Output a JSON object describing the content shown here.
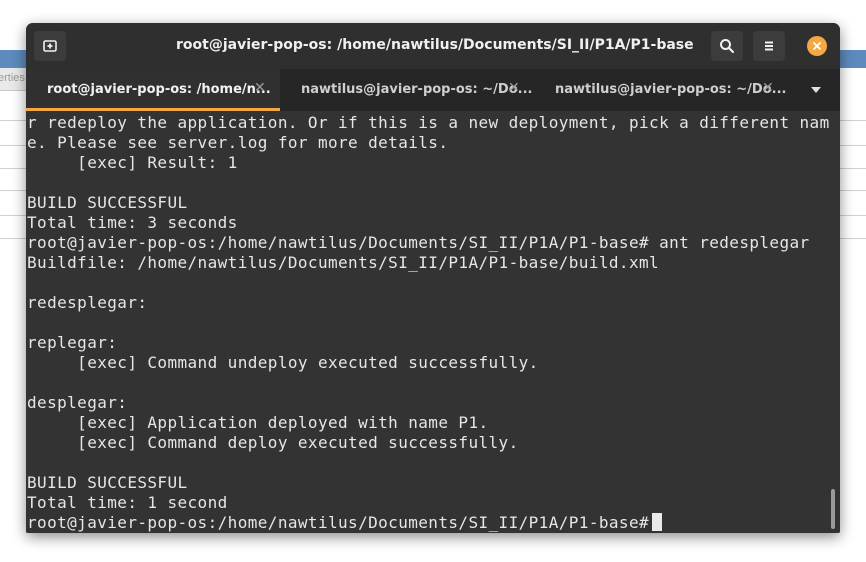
{
  "window": {
    "title": "root@javier-pop-os: /home/nawtilus/Documents/SI_II/P1A/P1-base"
  },
  "background": {
    "partial_label": "erties"
  },
  "tabs": [
    {
      "label": "root@javier-pop-os: /home/n...",
      "active": true
    },
    {
      "label": "nawtilus@javier-pop-os: ~/Do...",
      "active": false
    },
    {
      "label": "nawtilus@javier-pop-os: ~/Do...",
      "active": false
    }
  ],
  "terminal": {
    "lines": [
      "r redeploy the application. Or if this is a new deployment, pick a different nam",
      "e. Please see server.log for more details.",
      "     [exec] Result: 1",
      "",
      "BUILD SUCCESSFUL",
      "Total time: 3 seconds",
      "root@javier-pop-os:/home/nawtilus/Documents/SI_II/P1A/P1-base# ant redesplegar",
      "Buildfile: /home/nawtilus/Documents/SI_II/P1A/P1-base/build.xml",
      "",
      "redesplegar:",
      "",
      "replegar:",
      "     [exec] Command undeploy executed successfully.",
      "",
      "desplegar:",
      "     [exec] Application deployed with name P1.",
      "     [exec] Command deploy executed successfully.",
      "",
      "BUILD SUCCESSFUL",
      "Total time: 1 second"
    ],
    "prompt": "root@javier-pop-os:/home/nawtilus/Documents/SI_II/P1A/P1-base#"
  },
  "icons": {
    "new_tab": "new-tab-icon",
    "search": "search-icon",
    "menu": "hamburger-menu-icon",
    "close": "close-icon",
    "tab_close": "close-icon",
    "dropdown": "chevron-down-icon"
  },
  "colors": {
    "accent": "#f5a742",
    "titlebar": "#2f2f2f",
    "tabbar": "#262626",
    "terminal_bg": "#333333",
    "terminal_fg": "#e6e6e6"
  }
}
